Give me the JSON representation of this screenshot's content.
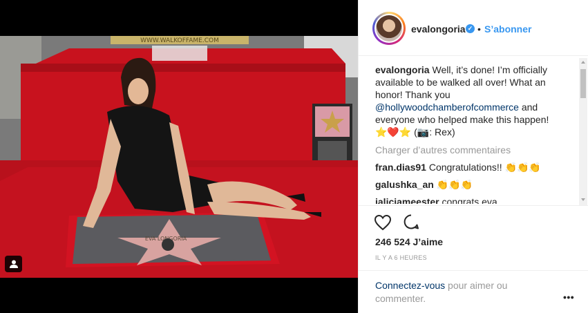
{
  "post": {
    "username": "evalongoria",
    "verified_mark": "✓",
    "separator": "•",
    "follow_label": "S’abonner",
    "caption_user": "evalongoria",
    "caption_text_1": " Well, it’s done! I’m officially available to be walked all over! What an honor! Thank you ",
    "caption_mention": "@hollywoodchamberofcommerce",
    "caption_text_2": " and everyone who helped make this happen! ⭐❤️⭐ (📷: Rex)",
    "load_more": "Charger d’autres commentaires",
    "comments": [
      {
        "user": "fran.dias91",
        "text": " Congratulations!! 👏👏👏"
      },
      {
        "user": "galushka_an",
        "text": " 👏👏👏"
      },
      {
        "user": "jaliciameester",
        "text": " congrats eva"
      }
    ],
    "likes": "246 524 J’aime",
    "time": "IL Y A 6 HEURES",
    "login_link": "Connectez-vous",
    "login_rest": " pour aimer ou commenter.",
    "more": "•••"
  },
  "photo": {
    "sign_text": "WWW.WALKOFFAME.COM",
    "star_name": "EVA LONGORIA"
  },
  "colors": {
    "link": "#3897f0",
    "mention": "#003569",
    "muted": "#999999",
    "carpet": "#c4121f"
  },
  "icons": [
    "verified-badge-icon",
    "heart-icon",
    "comment-icon",
    "user-tag-icon",
    "more-options-icon"
  ]
}
